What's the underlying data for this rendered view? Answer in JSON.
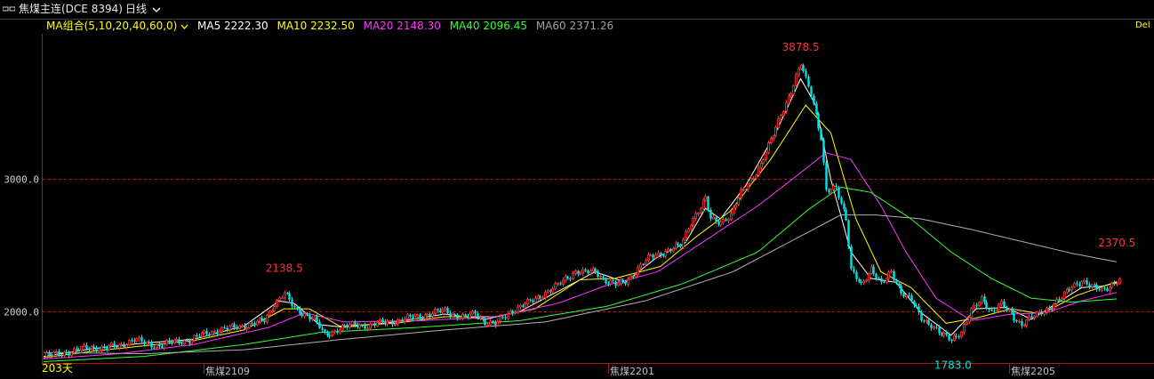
{
  "header": {
    "title": "焦煤主连(DCE 8394)",
    "period_label": "日线"
  },
  "ma_legend": {
    "group_label": "MA组合(5,10,20,40,60,0)",
    "items": [
      {
        "label": "MA5 2222.30",
        "color": "#ffffff"
      },
      {
        "label": "MA10 2232.50",
        "color": "#ffff00"
      },
      {
        "label": "MA20 2148.30",
        "color": "#ff33ff"
      },
      {
        "label": "MA40 2096.45",
        "color": "#33ff33"
      },
      {
        "label": "MA60 2371.26",
        "color": "#a0a0a0"
      }
    ],
    "right_label": "Del"
  },
  "chart_data": {
    "type": "candlestick",
    "y_ticks": [
      "3000.0",
      "2000.0"
    ],
    "x_labels": [
      "焦煤2109",
      "焦煤2201",
      "焦煤2205"
    ],
    "day_count_label": "203天",
    "annotations": {
      "high_1": "2138.5",
      "peak": "3878.5",
      "low": "1783.0",
      "last": "2370.5"
    },
    "colors": {
      "up": "#ff3232",
      "down": "#00e5e5",
      "grid": "#a02020"
    },
    "ylim": [
      1610,
      4100
    ],
    "close_points": [
      [
        0,
        1660
      ],
      [
        6,
        1680
      ],
      [
        12,
        1700
      ],
      [
        18,
        1730
      ],
      [
        24,
        1720
      ],
      [
        30,
        1740
      ],
      [
        36,
        1790
      ],
      [
        40,
        1760
      ],
      [
        46,
        1740
      ],
      [
        52,
        1770
      ],
      [
        58,
        1780
      ],
      [
        64,
        1830
      ],
      [
        70,
        1860
      ],
      [
        76,
        1880
      ],
      [
        82,
        1900
      ],
      [
        88,
        1930
      ],
      [
        92,
        2060
      ],
      [
        96,
        2138
      ],
      [
        100,
        2020
      ],
      [
        104,
        1980
      ],
      [
        108,
        1940
      ],
      [
        112,
        1820
      ],
      [
        118,
        1870
      ],
      [
        124,
        1900
      ],
      [
        130,
        1890
      ],
      [
        136,
        1920
      ],
      [
        142,
        1930
      ],
      [
        148,
        1960
      ],
      [
        154,
        1980
      ],
      [
        160,
        2010
      ],
      [
        164,
        1970
      ],
      [
        168,
        1950
      ],
      [
        172,
        1990
      ],
      [
        176,
        1920
      ],
      [
        180,
        1900
      ],
      [
        186,
        2000
      ],
      [
        192,
        2050
      ],
      [
        198,
        2120
      ],
      [
        204,
        2180
      ],
      [
        208,
        2250
      ],
      [
        212,
        2300
      ],
      [
        216,
        2290
      ],
      [
        220,
        2310
      ],
      [
        224,
        2230
      ],
      [
        228,
        2200
      ],
      [
        232,
        2230
      ],
      [
        236,
        2300
      ],
      [
        242,
        2420
      ],
      [
        248,
        2450
      ],
      [
        254,
        2500
      ],
      [
        258,
        2680
      ],
      [
        262,
        2780
      ],
      [
        264,
        2850
      ],
      [
        266,
        2700
      ],
      [
        270,
        2680
      ],
      [
        274,
        2720
      ],
      [
        278,
        2900
      ],
      [
        282,
        3000
      ],
      [
        286,
        3100
      ],
      [
        290,
        3300
      ],
      [
        294,
        3500
      ],
      [
        298,
        3650
      ],
      [
        302,
        3878
      ],
      [
        306,
        3660
      ],
      [
        310,
        3300
      ],
      [
        312,
        2900
      ],
      [
        316,
        2950
      ],
      [
        320,
        2700
      ],
      [
        322,
        2300
      ],
      [
        326,
        2200
      ],
      [
        330,
        2330
      ],
      [
        334,
        2200
      ],
      [
        338,
        2300
      ],
      [
        342,
        2150
      ],
      [
        346,
        2080
      ],
      [
        350,
        1950
      ],
      [
        354,
        1900
      ],
      [
        358,
        1820
      ],
      [
        362,
        1790
      ],
      [
        366,
        1850
      ],
      [
        370,
        2000
      ],
      [
        374,
        2100
      ],
      [
        378,
        2000
      ],
      [
        382,
        2050
      ],
      [
        386,
        1980
      ],
      [
        390,
        1900
      ],
      [
        394,
        1950
      ],
      [
        398,
        2000
      ],
      [
        402,
        2040
      ],
      [
        406,
        2100
      ],
      [
        410,
        2200
      ],
      [
        414,
        2230
      ],
      [
        418,
        2180
      ],
      [
        422,
        2170
      ],
      [
        426,
        2200
      ],
      [
        429,
        2230
      ]
    ],
    "ma_series": [
      {
        "name": "MA5",
        "color": "#ffffff",
        "points": [
          [
            0,
            1660
          ],
          [
            20,
            1720
          ],
          [
            40,
            1760
          ],
          [
            60,
            1790
          ],
          [
            80,
            1890
          ],
          [
            94,
            2080
          ],
          [
            100,
            2060
          ],
          [
            110,
            1900
          ],
          [
            120,
            1880
          ],
          [
            140,
            1920
          ],
          [
            160,
            1980
          ],
          [
            176,
            1940
          ],
          [
            190,
            2000
          ],
          [
            205,
            2150
          ],
          [
            220,
            2300
          ],
          [
            232,
            2220
          ],
          [
            244,
            2400
          ],
          [
            256,
            2520
          ],
          [
            264,
            2780
          ],
          [
            270,
            2700
          ],
          [
            280,
            2950
          ],
          [
            292,
            3350
          ],
          [
            302,
            3760
          ],
          [
            308,
            3560
          ],
          [
            314,
            3000
          ],
          [
            322,
            2450
          ],
          [
            330,
            2250
          ],
          [
            340,
            2220
          ],
          [
            350,
            1990
          ],
          [
            362,
            1820
          ],
          [
            372,
            2020
          ],
          [
            384,
            2030
          ],
          [
            394,
            1940
          ],
          [
            404,
            2060
          ],
          [
            414,
            2180
          ],
          [
            422,
            2190
          ],
          [
            429,
            2222
          ]
        ]
      },
      {
        "name": "MA10",
        "color": "#ffff00",
        "points": [
          [
            0,
            1650
          ],
          [
            20,
            1700
          ],
          [
            40,
            1740
          ],
          [
            60,
            1780
          ],
          [
            80,
            1860
          ],
          [
            96,
            2020
          ],
          [
            106,
            2020
          ],
          [
            118,
            1890
          ],
          [
            140,
            1910
          ],
          [
            160,
            1960
          ],
          [
            180,
            1960
          ],
          [
            196,
            2020
          ],
          [
            214,
            2240
          ],
          [
            228,
            2250
          ],
          [
            246,
            2340
          ],
          [
            260,
            2560
          ],
          [
            274,
            2760
          ],
          [
            290,
            3150
          ],
          [
            304,
            3560
          ],
          [
            314,
            3350
          ],
          [
            324,
            2700
          ],
          [
            334,
            2300
          ],
          [
            346,
            2180
          ],
          [
            360,
            1910
          ],
          [
            372,
            1950
          ],
          [
            386,
            2020
          ],
          [
            398,
            1980
          ],
          [
            412,
            2120
          ],
          [
            429,
            2232
          ]
        ]
      },
      {
        "name": "MA20",
        "color": "#ff33ff",
        "points": [
          [
            0,
            1640
          ],
          [
            30,
            1680
          ],
          [
            60,
            1750
          ],
          [
            90,
            1880
          ],
          [
            104,
            1990
          ],
          [
            120,
            1920
          ],
          [
            150,
            1930
          ],
          [
            180,
            1960
          ],
          [
            205,
            2060
          ],
          [
            225,
            2200
          ],
          [
            245,
            2300
          ],
          [
            265,
            2550
          ],
          [
            285,
            2800
          ],
          [
            300,
            3020
          ],
          [
            312,
            3200
          ],
          [
            322,
            3150
          ],
          [
            334,
            2800
          ],
          [
            344,
            2450
          ],
          [
            356,
            2100
          ],
          [
            370,
            1930
          ],
          [
            386,
            1980
          ],
          [
            400,
            1990
          ],
          [
            414,
            2080
          ],
          [
            429,
            2148
          ]
        ]
      },
      {
        "name": "MA40",
        "color": "#33ff33",
        "points": [
          [
            0,
            1620
          ],
          [
            40,
            1660
          ],
          [
            80,
            1750
          ],
          [
            110,
            1840
          ],
          [
            150,
            1880
          ],
          [
            190,
            1930
          ],
          [
            225,
            2040
          ],
          [
            255,
            2210
          ],
          [
            285,
            2450
          ],
          [
            305,
            2770
          ],
          [
            318,
            2940
          ],
          [
            330,
            2900
          ],
          [
            346,
            2700
          ],
          [
            362,
            2450
          ],
          [
            378,
            2250
          ],
          [
            394,
            2100
          ],
          [
            410,
            2070
          ],
          [
            429,
            2096
          ]
        ]
      },
      {
        "name": "MA60",
        "color": "#b0b0b0",
        "points": [
          [
            0,
            1690
          ],
          [
            40,
            1680
          ],
          [
            80,
            1710
          ],
          [
            120,
            1790
          ],
          [
            160,
            1860
          ],
          [
            200,
            1920
          ],
          [
            240,
            2080
          ],
          [
            275,
            2300
          ],
          [
            300,
            2550
          ],
          [
            318,
            2730
          ],
          [
            332,
            2730
          ],
          [
            350,
            2700
          ],
          [
            370,
            2620
          ],
          [
            390,
            2530
          ],
          [
            410,
            2440
          ],
          [
            429,
            2371
          ]
        ]
      }
    ]
  }
}
